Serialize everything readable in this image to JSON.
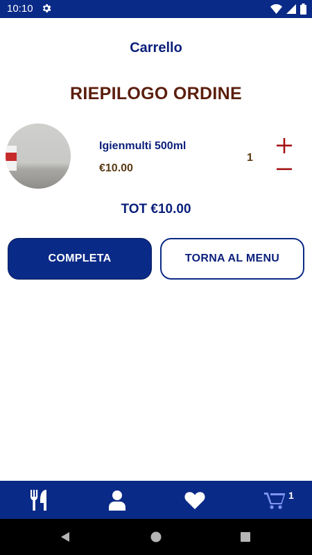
{
  "status_bar": {
    "time": "10:10",
    "icons": [
      "gear-icon",
      "wifi-icon",
      "signal-icon",
      "battery-icon"
    ]
  },
  "header": {
    "title": "Carrello"
  },
  "summary": {
    "heading": "RIEPILOGO ORDINE"
  },
  "cart_items": [
    {
      "name": "Igienmulti 500ml",
      "price": "€10.00",
      "quantity": "1"
    }
  ],
  "total": "TOT €10.00",
  "actions": {
    "complete_label": "COMPLETA",
    "back_label": "TORNA AL MENU"
  },
  "bottom_nav": {
    "items": [
      "menu-icon",
      "profile-icon",
      "favorites-icon",
      "cart-icon"
    ],
    "cart_count": "1"
  },
  "system_nav": [
    "back-icon",
    "home-icon",
    "recents-icon"
  ],
  "colors": {
    "primary": "#0a2a87",
    "heading": "#5b1e0d",
    "price": "#5b3a14",
    "qty_controls": "#a31212"
  }
}
